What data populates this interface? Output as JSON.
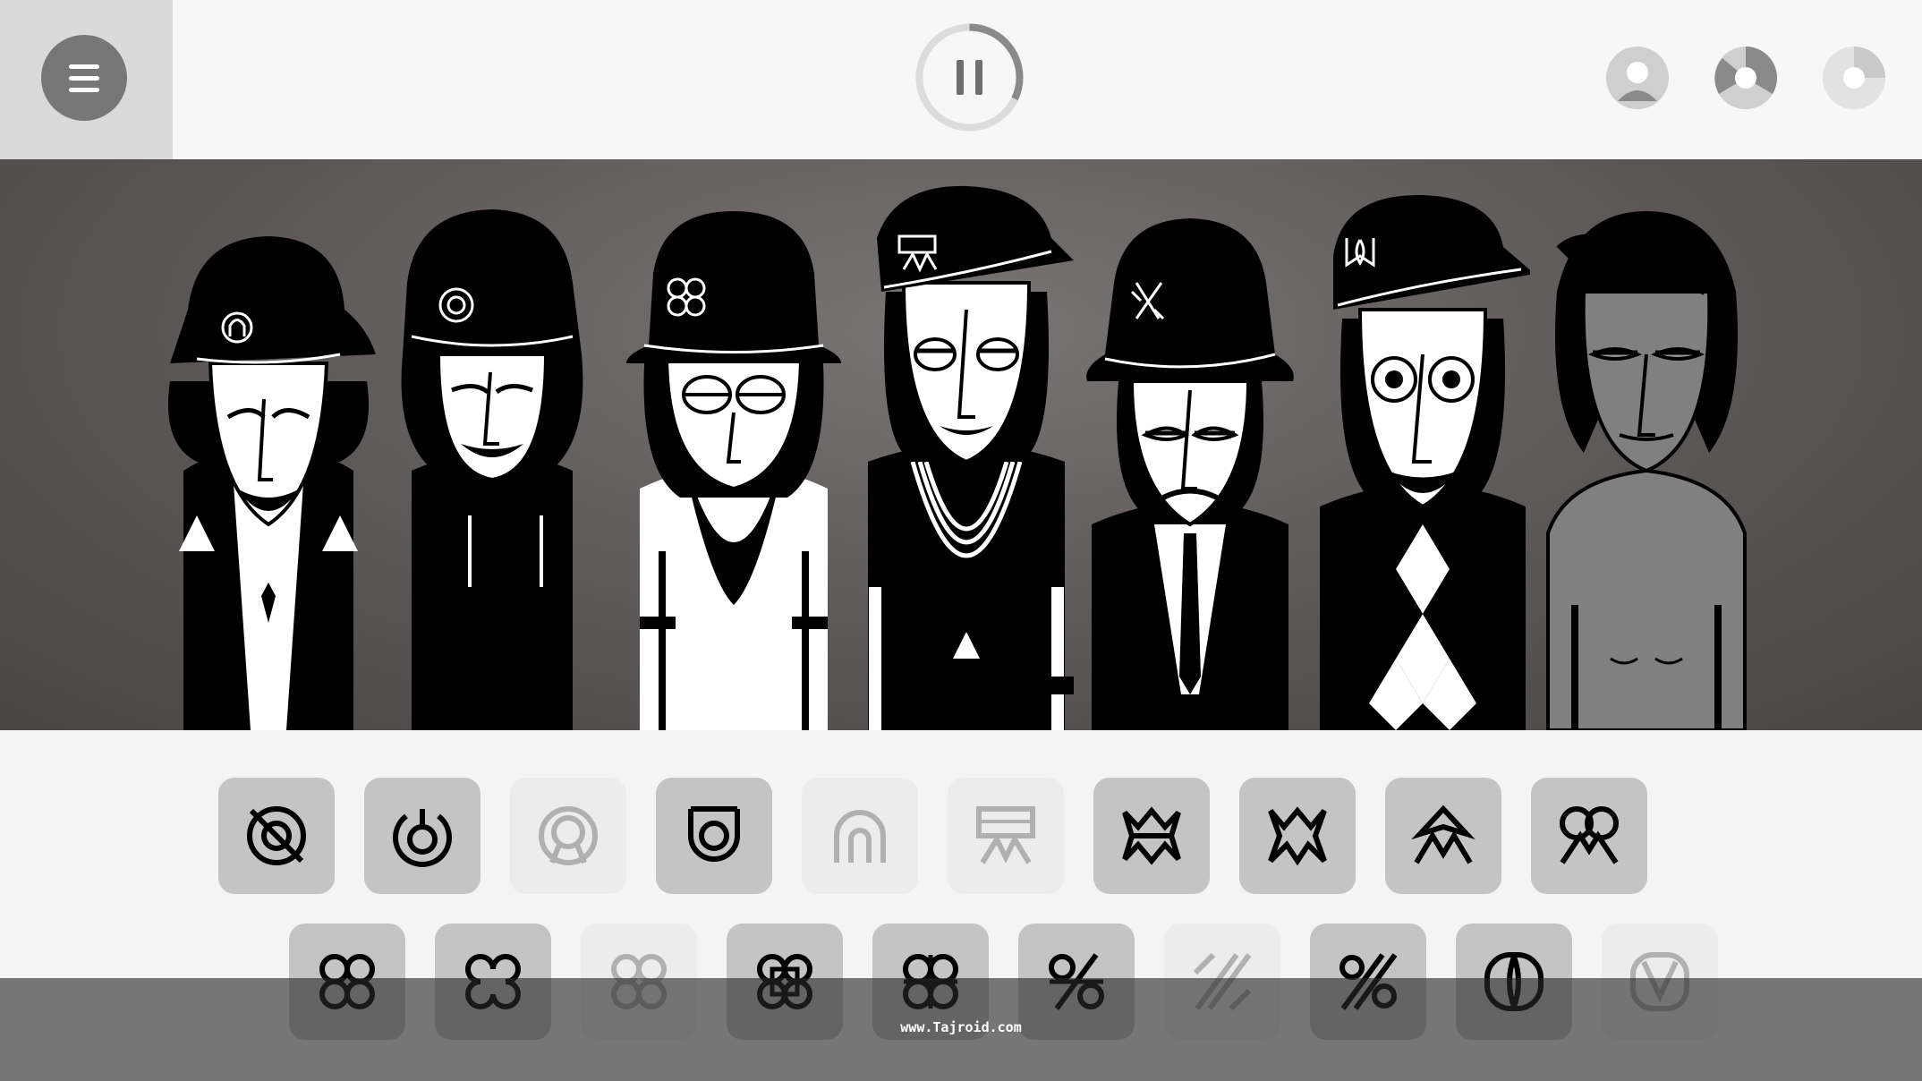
{
  "topbar": {
    "menu": {
      "icon": "menu-icon"
    },
    "pause": {
      "icon": "pause-icon",
      "progress": 0.32
    },
    "modes": [
      {
        "name": "mode-1",
        "icon": "mode-icon-1"
      },
      {
        "name": "mode-2",
        "icon": "mode-icon-2"
      },
      {
        "name": "mode-3",
        "icon": "mode-icon-3"
      }
    ]
  },
  "stage": {
    "characters": [
      {
        "name": "character-1",
        "hat": "hat",
        "body": "white-shirt-tie",
        "active": true
      },
      {
        "name": "character-2",
        "hat": "cap",
        "body": "hoodie",
        "active": true
      },
      {
        "name": "character-3",
        "hat": "fedora",
        "body": "beard-white-coat",
        "active": true
      },
      {
        "name": "character-4",
        "hat": "cap",
        "body": "necklace",
        "active": true
      },
      {
        "name": "character-5",
        "hat": "fedora",
        "body": "suit-tie",
        "active": true
      },
      {
        "name": "character-6",
        "hat": "cap",
        "body": "argyle",
        "active": true
      },
      {
        "name": "character-7",
        "hat": "none",
        "body": "shirtless",
        "active": false
      }
    ]
  },
  "sound_icons": {
    "row1": [
      {
        "icon": "crossed-target-icon",
        "enabled": true
      },
      {
        "icon": "power-ring-icon",
        "enabled": true
      },
      {
        "icon": "double-ring-icon",
        "enabled": false
      },
      {
        "icon": "bracket-ring-icon",
        "enabled": true
      },
      {
        "icon": "arch-ring-icon",
        "enabled": false
      },
      {
        "icon": "banner-icon",
        "enabled": false
      },
      {
        "icon": "burst-icon",
        "enabled": true
      },
      {
        "icon": "crown-icon",
        "enabled": true
      },
      {
        "icon": "diamond-peak-icon",
        "enabled": true
      },
      {
        "icon": "loops-icon",
        "enabled": true
      }
    ],
    "row2": [
      {
        "icon": "clover-icon",
        "enabled": true
      },
      {
        "icon": "clover-open-icon",
        "enabled": true
      },
      {
        "icon": "clover-faded-icon",
        "enabled": false
      },
      {
        "icon": "clover-square-icon",
        "enabled": true
      },
      {
        "icon": "clover-cross-icon",
        "enabled": true
      },
      {
        "icon": "percent-icon",
        "enabled": true
      },
      {
        "icon": "percent-faded-icon",
        "enabled": false
      },
      {
        "icon": "percent-double-icon",
        "enabled": true
      },
      {
        "icon": "zero-slash-icon",
        "enabled": true
      },
      {
        "icon": "heart-v-icon",
        "enabled": false
      }
    ]
  },
  "footer": {
    "watermark": "www.Tajroid.com"
  },
  "colors": {
    "topbar": "#f7f7f7",
    "menu_panel": "#dadada",
    "stage": "#5c5757",
    "icon_active": "#c4c4c4",
    "icon_inactive": "#ececec"
  }
}
